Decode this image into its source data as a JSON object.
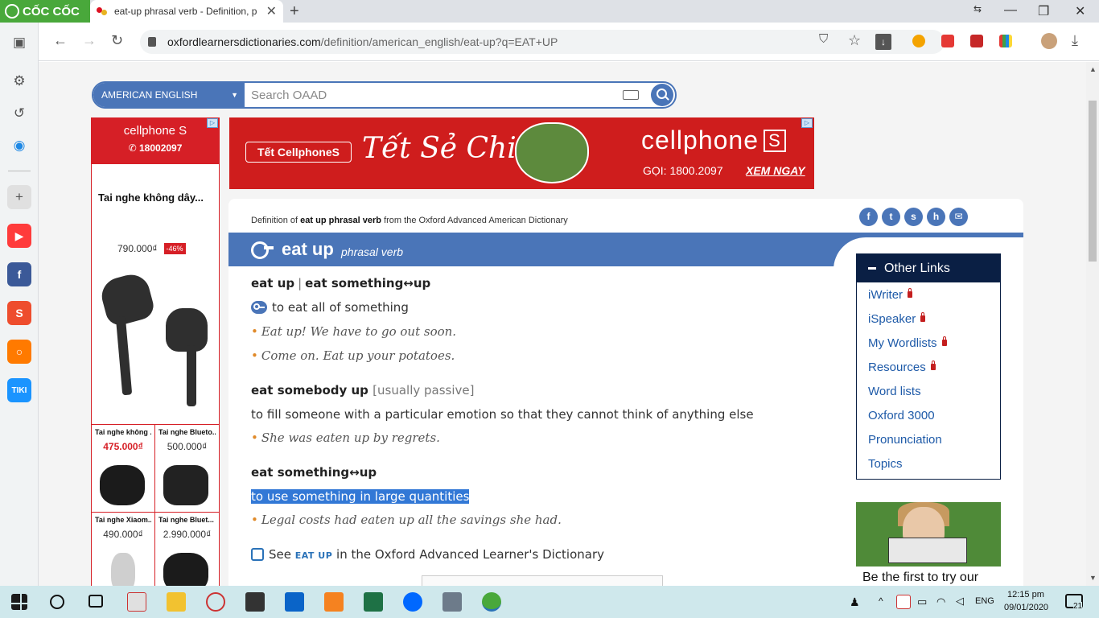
{
  "browser": {
    "brand": "CỐC CỐC",
    "tab_title": "eat-up phrasal verb - Definition, p",
    "new_tab": "+",
    "url_host": "oxfordlearnersdictionaries.com",
    "url_path": "/definition/american_english/eat-up?q=EAT+UP"
  },
  "search": {
    "dictionary": "AMERICAN ENGLISH",
    "placeholder": "Search OAAD"
  },
  "left_ad": {
    "brand": "cellphone S",
    "phone": "✆ 18002097",
    "product": "Tai nghe không dây...",
    "price": "790.000₫",
    "discount": "-46%",
    "grid": [
      {
        "name": "Tai nghe không ...",
        "price": "475.000₫"
      },
      {
        "name": "Tai nghe Blueto...",
        "price": "500.000₫"
      },
      {
        "name": "Tai nghe Xiaom...",
        "price": "490.000₫"
      },
      {
        "name": "Tai nghe Bluet...",
        "price": "2.990.000₫"
      }
    ]
  },
  "banner": {
    "tag": "Tết CellphoneS",
    "slogan": "Tết Sẻ Chia",
    "brand": "cellphone",
    "brand_s": "S",
    "phone": "GỌI: 1800.2097",
    "cta": "XEM NGAY"
  },
  "entry": {
    "definition_of_prefix": "Definition of ",
    "definition_of_word": "eat up phrasal verb",
    "definition_of_suffix": " from the Oxford Advanced American Dictionary",
    "headword": "eat up",
    "pos": "phrasal verb",
    "sense1_head_a": "eat up",
    "sense1_head_sep": "|",
    "sense1_head_b": "eat something↔up",
    "sense1_def": "to eat all of something",
    "sense1_ex1": "Eat up! We have to go out soon.",
    "sense1_ex2": "Come on. Eat up your potatoes.",
    "sense2_head": "eat somebody up",
    "sense2_gram": "[usually passive]",
    "sense2_def": "to fill someone with a particular emotion so that they cannot think of anything else",
    "sense2_ex1": "She was eaten up by regrets.",
    "sense3_head": "eat something↔up",
    "sense3_def": "to use something in large quantities",
    "sense3_ex1": "Legal costs had eaten up all the savings she had.",
    "see_prefix": "See ",
    "see_word": "EAT UP",
    "see_suffix": " in the Oxford Advanced Learner's Dictionary",
    "bullet": "•"
  },
  "other_links": {
    "title": "Other Links",
    "items": [
      {
        "label": "iWriter",
        "locked": true
      },
      {
        "label": "iSpeaker",
        "locked": true
      },
      {
        "label": "My Wordlists",
        "locked": true
      },
      {
        "label": "Resources",
        "locked": true
      },
      {
        "label": "Word lists",
        "locked": false
      },
      {
        "label": "Oxford 3000",
        "locked": false
      },
      {
        "label": "Pronunciation",
        "locked": false
      },
      {
        "label": "Topics",
        "locked": false
      }
    ]
  },
  "promo": {
    "text": "Be the first to try our"
  },
  "taskbar": {
    "language": "ENG",
    "time": "12:15 pm",
    "date": "09/01/2020",
    "notifications": "21"
  },
  "colors": {
    "oxford_blue": "#4a75b8",
    "navy": "#0a1f44",
    "ad_red": "#d61f26",
    "coccoc_green": "#49a83b",
    "highlight": "#3278d6"
  }
}
